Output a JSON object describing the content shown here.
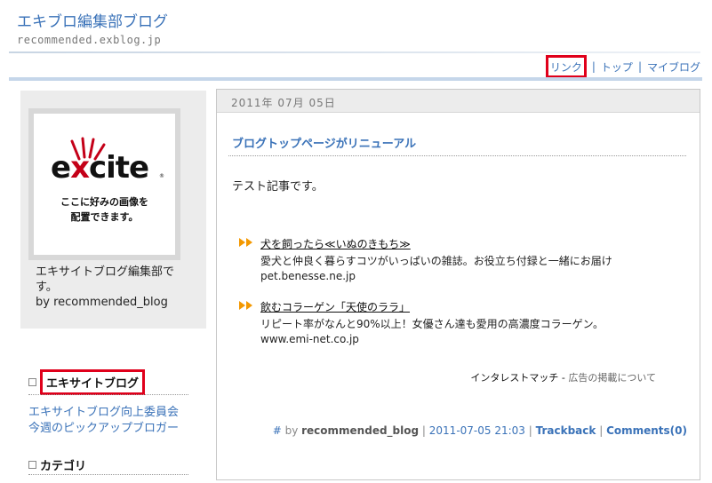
{
  "header": {
    "title": "エキブロ編集部ブログ",
    "url": "recommended.exblog.jp"
  },
  "nav": {
    "links": [
      "リンク",
      "トップ",
      "マイブログ"
    ],
    "separator": "|",
    "highlight_color": "#e0001b"
  },
  "sidebar": {
    "profile_image": {
      "logo": "excite",
      "caption_line1": "ここに好みの画像を",
      "caption_line2": "配置できます。"
    },
    "profile_name": "エキサイトブログ編集部です。",
    "profile_byline": "by recommended_blog",
    "sections": [
      {
        "heading": "エキサイトブログ",
        "links": [
          "エキサイトブログ向上委員会",
          "今週のピックアップブロガー"
        ]
      },
      {
        "heading": "カテゴリ",
        "links": []
      }
    ]
  },
  "post": {
    "date": "2011年 07月 05日",
    "title": "ブログトップページがリニューアル",
    "body": "テスト記事です。",
    "ads": [
      {
        "title": "犬を飼ったら≪いぬのきもち≫",
        "description": "愛犬と仲良く暮らすコツがいっぱいの雑誌。お役立ち付録と一緒にお届け",
        "domain": "pet.benesse.ne.jp"
      },
      {
        "title": "飲むコラーゲン「天使のララ」",
        "description": "リピート率がなんと90%以上！女優さん達も愛用の高濃度コラーゲン。",
        "domain": "www.emi-net.co.jp"
      }
    ],
    "ad_credit": "インタレストマッチ",
    "ad_credit_sep": " - ",
    "ad_about": "広告の掲載について",
    "footer": {
      "hash": "#",
      "by": "by",
      "author": "recommended_blog",
      "timestamp": "2011-07-05 21:03",
      "trackback": "Trackback",
      "comments": "Comments(0)"
    }
  },
  "colors": {
    "link_blue": "#3a72b8",
    "ad_arrow": "#f39800"
  }
}
